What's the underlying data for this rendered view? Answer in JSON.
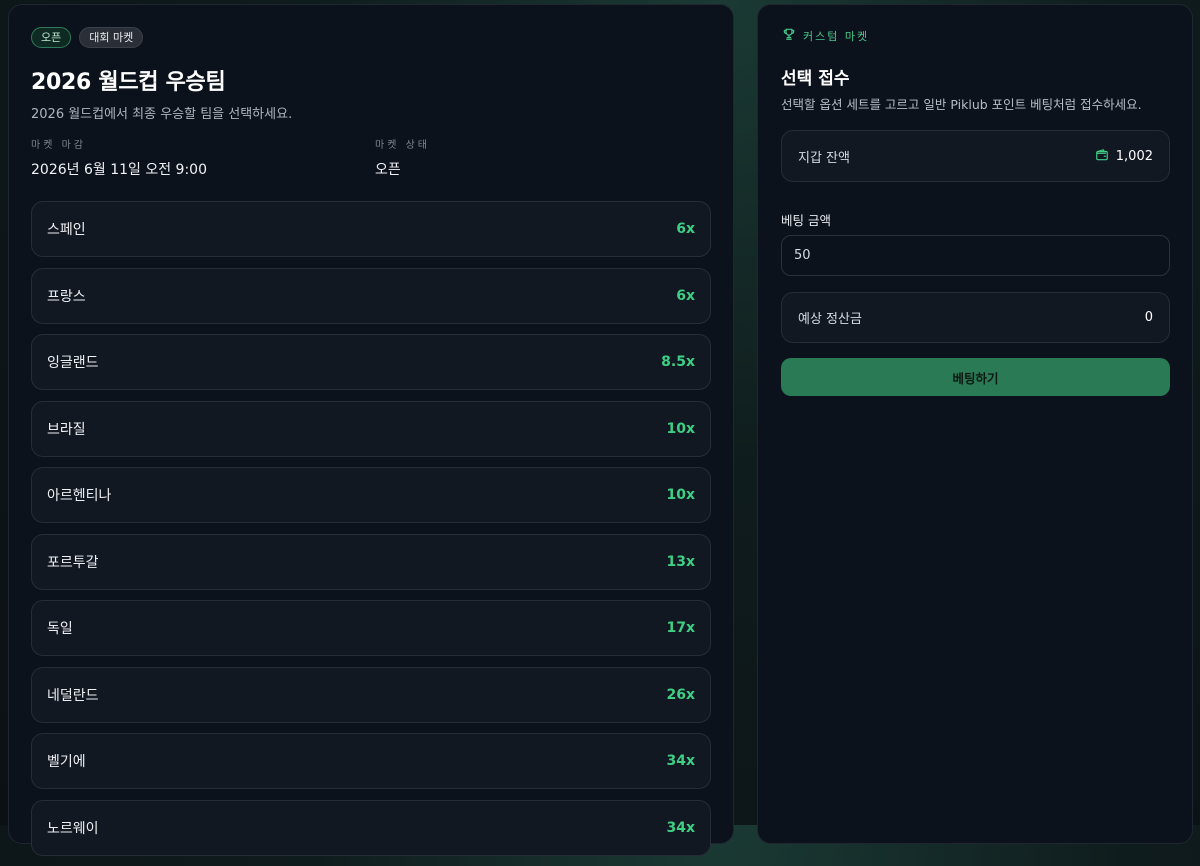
{
  "market": {
    "badges": {
      "status": "오픈",
      "category": "대회 마켓"
    },
    "title": "2026 월드컵 우승팀",
    "subtitle": "2026 월드컵에서 최종 우승할 팀을 선택하세요.",
    "close": {
      "label": "마켓 마감",
      "value": "2026년 6월 11일 오전 9:00"
    },
    "status": {
      "label": "마켓 상태",
      "value": "오픈"
    },
    "options": [
      {
        "name": "스페인",
        "odds": "6x"
      },
      {
        "name": "프랑스",
        "odds": "6x"
      },
      {
        "name": "잉글랜드",
        "odds": "8.5x"
      },
      {
        "name": "브라질",
        "odds": "10x"
      },
      {
        "name": "아르헨티나",
        "odds": "10x"
      },
      {
        "name": "포르투갈",
        "odds": "13x"
      },
      {
        "name": "독일",
        "odds": "17x"
      },
      {
        "name": "네덜란드",
        "odds": "26x"
      },
      {
        "name": "벨기에",
        "odds": "34x"
      },
      {
        "name": "노르웨이",
        "odds": "34x"
      }
    ]
  },
  "betslip": {
    "eyebrow": "커스텀 마켓",
    "eyebrow_icon": "trophy-icon",
    "title": "선택 접수",
    "subtitle": "선택할 옵션 세트를 고르고 일반 Piklub 포인트 베팅처럼 접수하세요.",
    "wallet": {
      "label": "지갑 잔액",
      "icon": "wallet-icon",
      "value": "1,002"
    },
    "amount": {
      "label": "베팅 금액",
      "value": "50"
    },
    "payout": {
      "label": "예상 정산금",
      "value": "0"
    },
    "submit_label": "베팅하기"
  },
  "colors": {
    "accent": "#3ecf84",
    "button": "#2a7a55",
    "panel": "#0c121b",
    "card": "#121822"
  }
}
